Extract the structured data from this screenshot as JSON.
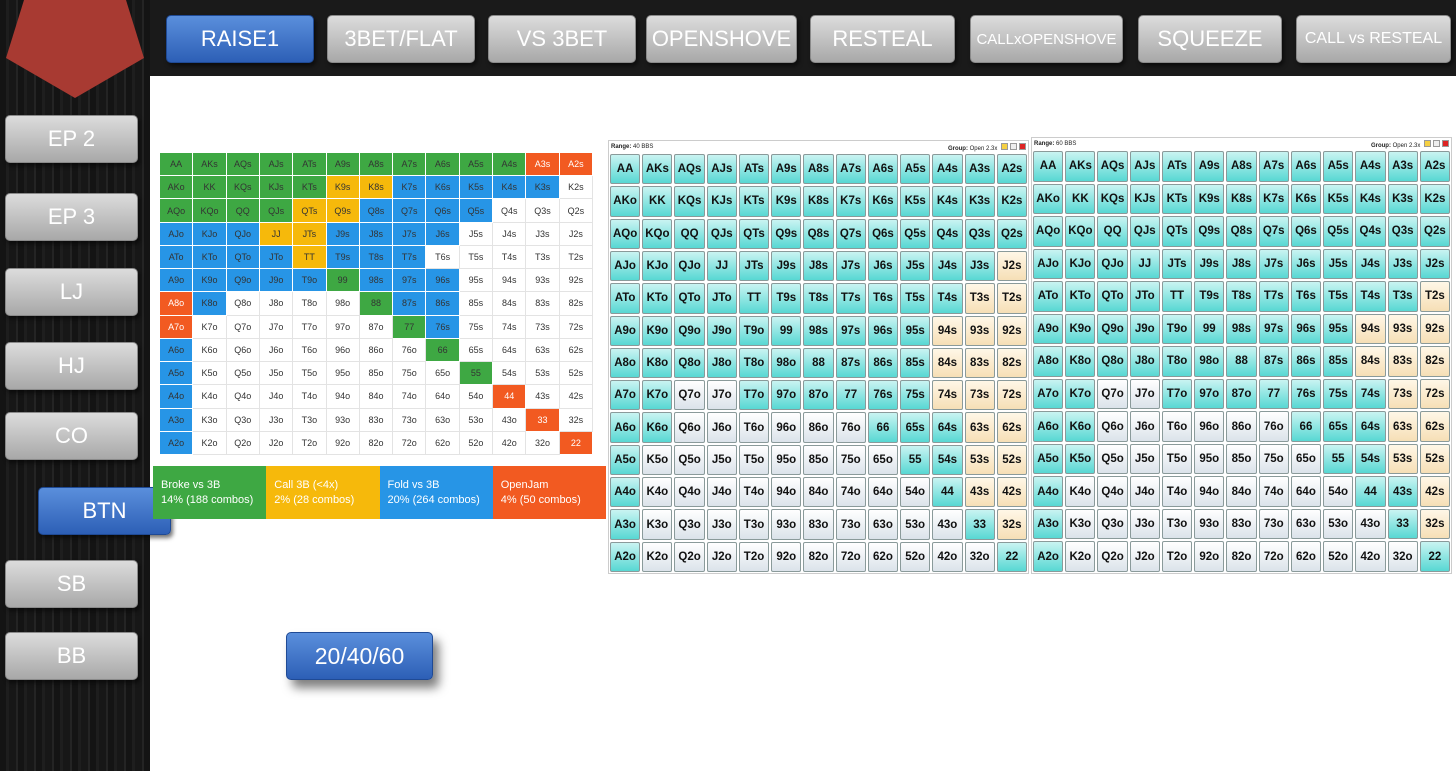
{
  "nav": {
    "tabs": [
      {
        "label": "RAISE1",
        "active": true,
        "icon": ""
      },
      {
        "label": "3BET/FLAT",
        "active": false
      },
      {
        "label": "VS 3BET",
        "active": false
      },
      {
        "label": "OPENSHOVE",
        "active": false
      },
      {
        "label": "RESTEAL",
        "active": false
      },
      {
        "label": "CALLxOPENSHOVE",
        "active": false
      },
      {
        "label": "SQUEEZE",
        "active": false
      },
      {
        "label": "CALL vs RESTEAL",
        "active": false
      }
    ]
  },
  "positions": [
    {
      "label": "EP 2",
      "active": false
    },
    {
      "label": "EP 3",
      "active": false
    },
    {
      "label": "LJ",
      "active": false
    },
    {
      "label": "HJ",
      "active": false
    },
    {
      "label": "CO",
      "active": false
    },
    {
      "label": "BTN",
      "active": true
    },
    {
      "label": "SB",
      "active": false
    },
    {
      "label": "BB",
      "active": false
    }
  ],
  "stack_button": {
    "label": "20/40/60"
  },
  "colors": {
    "raise": "#3ea843",
    "call": "#f6b90b",
    "fold": "#2795e6",
    "jam": "#f25a21",
    "accent": "#2d5fb6",
    "logo": "#a83a32"
  },
  "hands": [
    [
      "AA",
      "AKs",
      "AQs",
      "AJs",
      "ATs",
      "A9s",
      "A8s",
      "A7s",
      "A6s",
      "A5s",
      "A4s",
      "A3s",
      "A2s"
    ],
    [
      "AKo",
      "KK",
      "KQs",
      "KJs",
      "KTs",
      "K9s",
      "K8s",
      "K7s",
      "K6s",
      "K5s",
      "K4s",
      "K3s",
      "K2s"
    ],
    [
      "AQo",
      "KQo",
      "QQ",
      "QJs",
      "QTs",
      "Q9s",
      "Q8s",
      "Q7s",
      "Q6s",
      "Q5s",
      "Q4s",
      "Q3s",
      "Q2s"
    ],
    [
      "AJo",
      "KJo",
      "QJo",
      "JJ",
      "JTs",
      "J9s",
      "J8s",
      "J7s",
      "J6s",
      "J5s",
      "J4s",
      "J3s",
      "J2s"
    ],
    [
      "ATo",
      "KTo",
      "QTo",
      "JTo",
      "TT",
      "T9s",
      "T8s",
      "T7s",
      "T6s",
      "T5s",
      "T4s",
      "T3s",
      "T2s"
    ],
    [
      "A9o",
      "K9o",
      "Q9o",
      "J9o",
      "T9o",
      "99",
      "98s",
      "97s",
      "96s",
      "95s",
      "94s",
      "93s",
      "92s"
    ],
    [
      "A8o",
      "K8o",
      "Q8o",
      "J8o",
      "T8o",
      "98o",
      "88",
      "87s",
      "86s",
      "85s",
      "84s",
      "83s",
      "82s"
    ],
    [
      "A7o",
      "K7o",
      "Q7o",
      "J7o",
      "T7o",
      "97o",
      "87o",
      "77",
      "76s",
      "75s",
      "74s",
      "73s",
      "72s"
    ],
    [
      "A6o",
      "K6o",
      "Q6o",
      "J6o",
      "T6o",
      "96o",
      "86o",
      "76o",
      "66",
      "65s",
      "64s",
      "63s",
      "62s"
    ],
    [
      "A5o",
      "K5o",
      "Q5o",
      "J5o",
      "T5o",
      "95o",
      "85o",
      "75o",
      "65o",
      "55",
      "54s",
      "53s",
      "52s"
    ],
    [
      "A4o",
      "K4o",
      "Q4o",
      "J4o",
      "T4o",
      "94o",
      "84o",
      "74o",
      "64o",
      "54o",
      "44",
      "43s",
      "42s"
    ],
    [
      "A3o",
      "K3o",
      "Q3o",
      "J3o",
      "T3o",
      "93o",
      "83o",
      "73o",
      "63o",
      "53o",
      "43o",
      "33",
      "32s"
    ],
    [
      "A2o",
      "K2o",
      "Q2o",
      "J2o",
      "T2o",
      "92o",
      "82o",
      "72o",
      "62o",
      "52o",
      "42o",
      "32o",
      "22"
    ]
  ],
  "chart_colors": [
    "GGGGGGGGGGGOO",
    "GGGGGYYBBBBBW",
    "GGGGYYBBBBWWW",
    "BBBYYBBBBWWWW",
    "BBBBYBBBWWWWW",
    "BBBBBGBBBWWWW",
    "OBWWWWGBBWWWW",
    "OWWWWWWGBWWWW",
    "BWWWWWWWGWWWW",
    "BWWWWWWWWGWWW",
    "BWWWWWWWWWOWW",
    "BWWWWWWWWWWOW",
    "BWWWWWWWWWWWO"
  ],
  "legend": [
    {
      "title": "Broke vs 3B",
      "sub": "14% (188 combos)",
      "color": "#3ea843"
    },
    {
      "title": "Call 3B (<4x)",
      "sub": "2% (28 combos)",
      "color": "#f6b90b"
    },
    {
      "title": "Fold vs 3B",
      "sub": "20% (264 combos)",
      "color": "#2795e6"
    },
    {
      "title": "OpenJam",
      "sub": "4% (50 combos)",
      "color": "#f25a21"
    }
  ],
  "panels": [
    {
      "range_label": "Range:",
      "range_value": "40 BBS",
      "group_label": "Group:",
      "group_value": "Open 2.3x",
      "fills": [
        "TTTTTTTTTTTTT",
        "TTTTTTTTTTTTT",
        "TTTTTTTTTTTTT",
        "TTTTTTTTTTTTP",
        "TTTTTTTTTTTPP",
        "TTTTTTTTTTPPP",
        "TTTTTTTTTTPPP",
        "TTWWTTTTTTPPP",
        "TTWWWWWWTTTPP",
        "TWWWWWWWWTTPP",
        "TWWWWWWWWWTPP",
        "TWWWWWWWWWWTP",
        "TWWWWWWWWWWWT"
      ]
    },
    {
      "range_label": "Range:",
      "range_value": "60 BBS",
      "group_label": "Group:",
      "group_value": "Open 2.3x",
      "fills": [
        "TTTTTTTTTTTTT",
        "TTTTTTTTTTTTT",
        "TTTTTTTTTTTTT",
        "TTTTTTTTTTTTT",
        "TTTTTTTTTTTTP",
        "TTTTTTTTTTPPP",
        "TTTTTTTTTTPPP",
        "TTWWTTTTTTTPP",
        "TTWWWWWWTTTPP",
        "TTWWWWWWWTTPP",
        "TWWWWWWWWWTTP",
        "TWWWWWWWWWWTP",
        "TWWWWWWWWWWWT"
      ]
    }
  ]
}
